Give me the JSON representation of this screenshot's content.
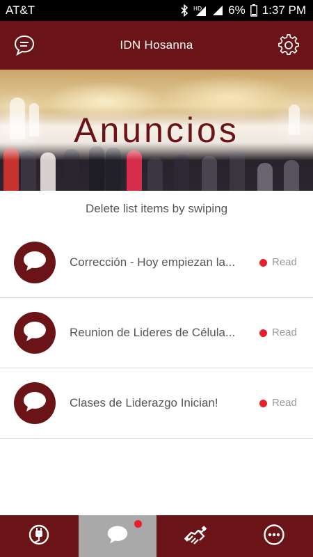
{
  "status_bar": {
    "carrier": "AT&T",
    "battery": "6%",
    "time": "1:37 PM",
    "icons": [
      "bluetooth-icon",
      "hd-signal-icon",
      "cell-signal-icon",
      "battery-icon"
    ]
  },
  "app_bar": {
    "title": "IDN Hosanna",
    "left_icon": "chat-bubble-icon",
    "right_icon": "gear-icon"
  },
  "hero": {
    "title": "Anuncios"
  },
  "hint": "Delete list items by swiping",
  "announcements": [
    {
      "title": "Corrección - Hoy empiezan la...",
      "status": "Read",
      "unread": true
    },
    {
      "title": "Reunion de Lideres de Célula...",
      "status": "Read",
      "unread": true
    },
    {
      "title": "Clases de Liderazgo Inician!",
      "status": "Read",
      "unread": true
    }
  ],
  "bottom_nav": {
    "tabs": [
      {
        "icon": "power-plug-icon",
        "active": false
      },
      {
        "icon": "chat-bubble-icon",
        "active": true,
        "badge": true
      },
      {
        "icon": "handshake-icon",
        "active": false
      },
      {
        "icon": "more-options-icon",
        "active": false
      }
    ]
  },
  "colors": {
    "primary": "#6b1418",
    "badge": "#e8202a",
    "active_tab": "#a9a9a9",
    "text_gray": "#555555"
  }
}
